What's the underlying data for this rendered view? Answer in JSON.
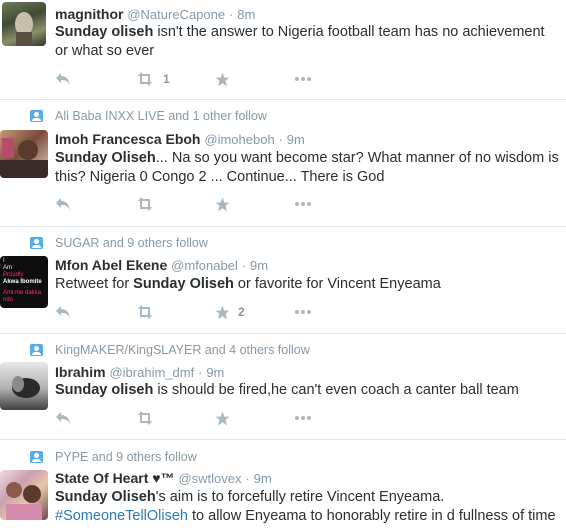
{
  "tweets": [
    {
      "context": "",
      "fullname": "magnithor",
      "username": "@NatureCapone",
      "time": "8m",
      "text_pre": "",
      "text_bold": "Sunday oliseh",
      "text_post": " isn't the answer to Nigeria football team has no achievement or what so ever",
      "hashtag": "",
      "text_after_hashtag": "",
      "retweets": "1",
      "favorites": ""
    },
    {
      "context": "Ali Baba INXX LIVE and 1 other follow",
      "fullname": "Imoh Francesca Eboh",
      "username": "@imoheboh",
      "time": "9m",
      "text_pre": "",
      "text_bold": "Sunday Oliseh",
      "text_post": "... Na so you want become star? What manner of no wisdom is this? Nigeria 0 Congo 2 ... Continue... There is God",
      "hashtag": "",
      "text_after_hashtag": "",
      "retweets": "",
      "favorites": ""
    },
    {
      "context": "SUGAR and 9 others follow",
      "fullname": "Mfon Abel Ekene",
      "username": "@mfonabel",
      "time": "9m",
      "text_pre": "Retweet for ",
      "text_bold": "Sunday Oliseh",
      "text_post": " or favorite for Vincent Enyeama",
      "hashtag": "",
      "text_after_hashtag": "",
      "retweets": "",
      "favorites": "2",
      "avatar_text": [
        "I",
        "Am",
        "Proudly",
        "Akwa Ibomite",
        "Ami me dakka ndo"
      ]
    },
    {
      "context": "KingMAKER/KingSLAYER and 4 others follow",
      "fullname": "Ibrahim",
      "username": "@ibrahim_dmf",
      "time": "9m",
      "text_pre": "",
      "text_bold": "Sunday oliseh",
      "text_post": " is should be fired,he can't even coach a canter ball team",
      "hashtag": "",
      "text_after_hashtag": "",
      "retweets": "",
      "favorites": ""
    },
    {
      "context": "PYPE and 9 others follow",
      "fullname": "State Of Heart ♥™",
      "username": "@swtlovex",
      "time": "9m",
      "text_pre": "",
      "text_bold": "Sunday Oliseh",
      "text_post": "'s aim is to forcefully retire Vincent Enyeama.",
      "hashtag": "#SomeoneTellOliseh",
      "text_after_hashtag": " to allow Enyeama to honorably retire in d fullness of time",
      "retweets": "",
      "favorites": ""
    }
  ],
  "colors": {
    "accent": "#55acee",
    "muted": "#8899a6",
    "link": "#2b7bb9",
    "text": "#292f33"
  }
}
